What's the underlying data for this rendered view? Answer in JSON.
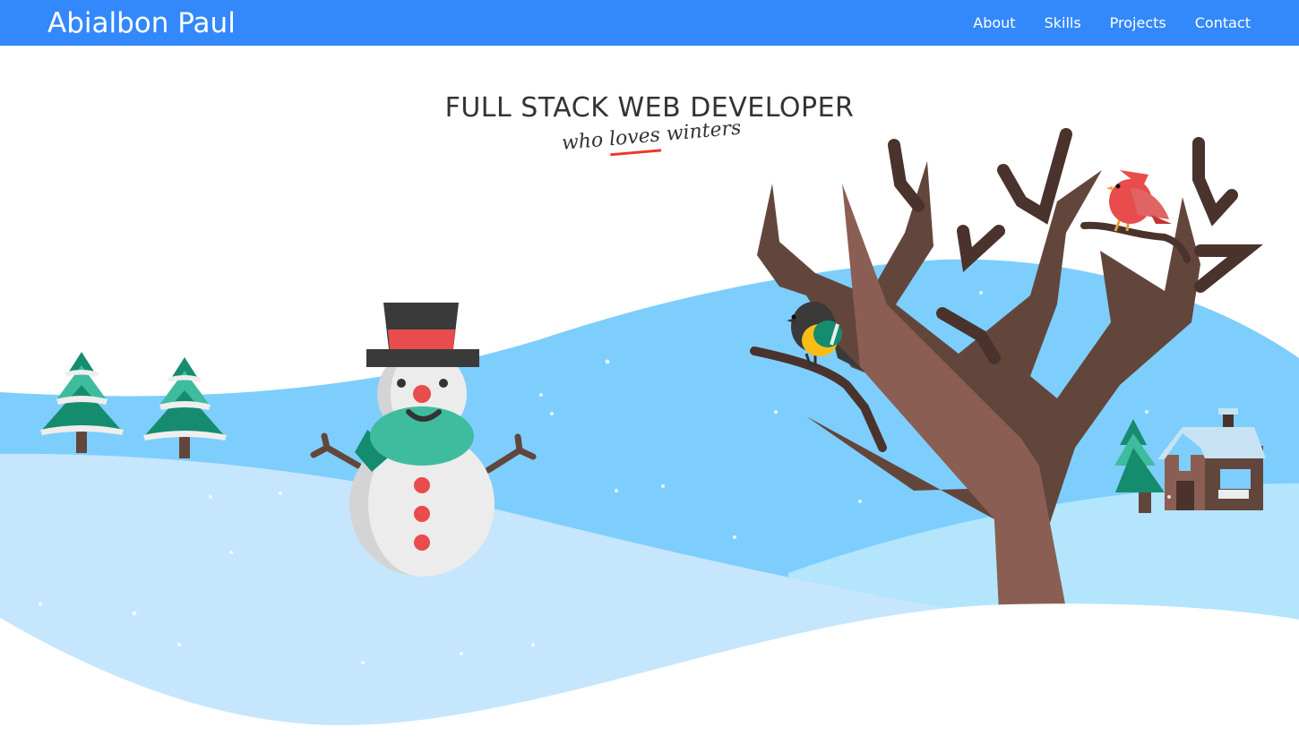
{
  "header": {
    "brand": "Abialbon Paul",
    "nav": [
      {
        "label": "About"
      },
      {
        "label": "Skills"
      },
      {
        "label": "Projects"
      },
      {
        "label": "Contact"
      }
    ]
  },
  "hero": {
    "title": "FULL STACK WEB DEVELOPER",
    "tagline_pre": "who",
    "tagline_emph": "loves",
    "tagline_post": "winters"
  },
  "colors": {
    "navbar": "#3388fb",
    "sky_hill": "#7ecefd",
    "light_hill": "#c5e6fd",
    "right_hill": "#b3e5fc",
    "underline": "#f0362a"
  }
}
